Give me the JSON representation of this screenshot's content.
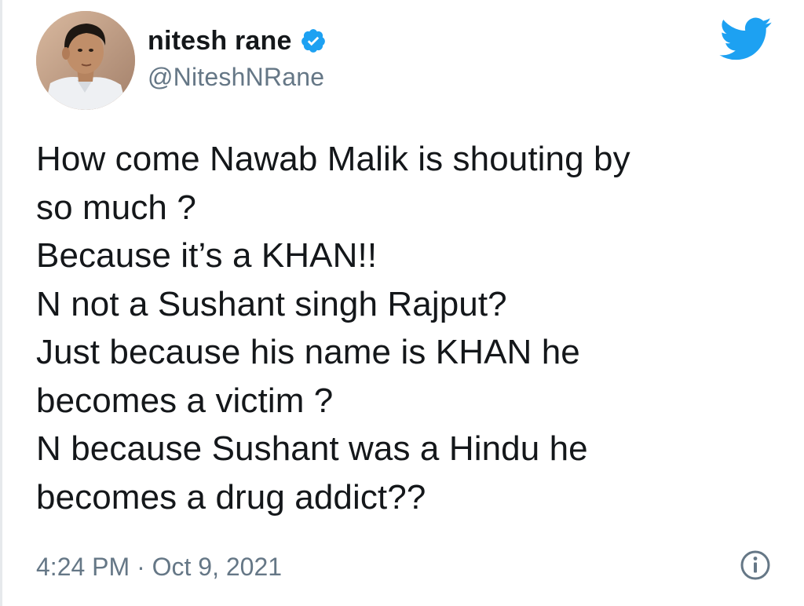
{
  "author": {
    "display_name": "nitesh rane",
    "handle": "@NiteshNRane",
    "verified": true,
    "avatar_icon": "profile-photo"
  },
  "tweet": {
    "lines": [
      "How come Nawab Malik is shouting by",
      "so much ?",
      "Because it’s a KHAN!!",
      "N not a Sushant singh Rajput?",
      "Just because his name is KHAN he",
      "becomes a victim ?",
      "N because Sushant was a Hindu he",
      "becomes a drug addict??"
    ]
  },
  "meta": {
    "time": "4:24 PM",
    "separator": "·",
    "date": "Oct 9, 2021"
  },
  "icons": {
    "brand": "twitter-bird-icon",
    "verified": "verified-badge-icon",
    "info": "info-icon"
  },
  "colors": {
    "brand_blue": "#1DA1F2",
    "text_primary": "#14171A",
    "text_secondary": "#657786"
  }
}
